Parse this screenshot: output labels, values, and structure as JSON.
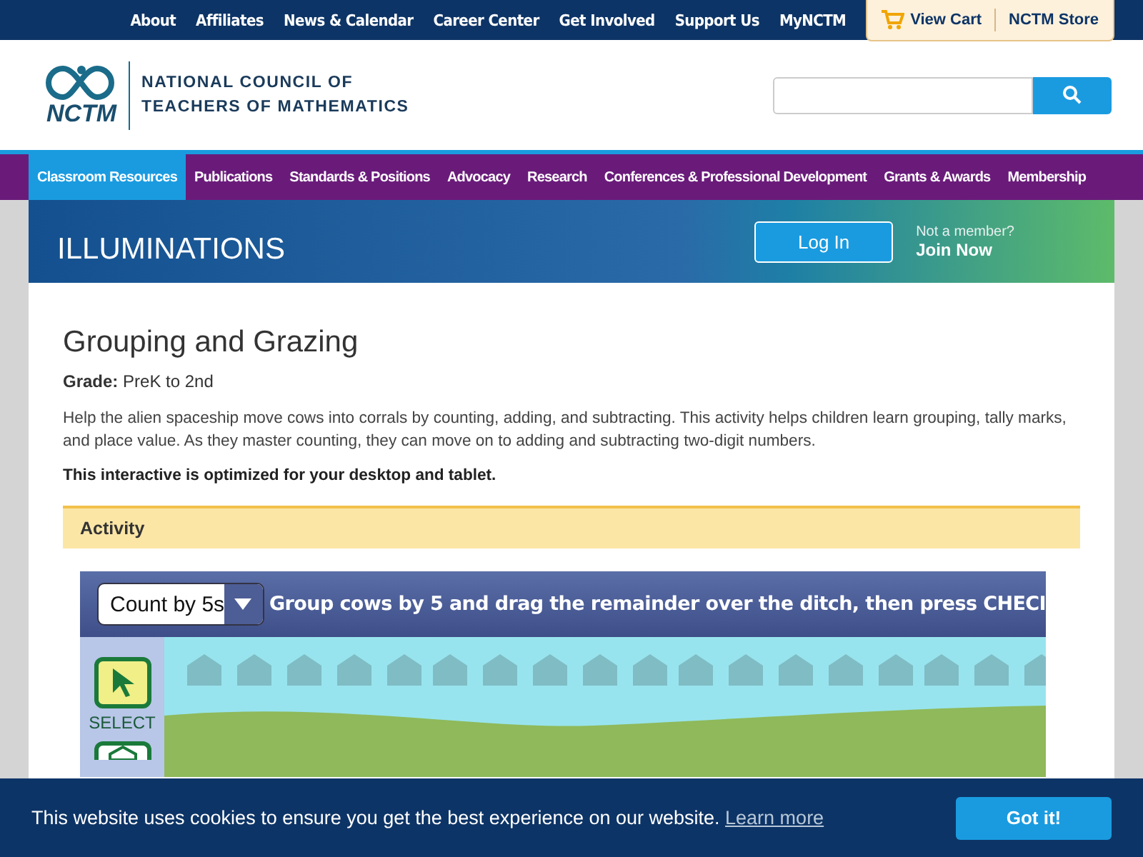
{
  "top_links": [
    "About",
    "Affiliates",
    "News & Calendar",
    "Career Center",
    "Get Involved",
    "Support Us",
    "MyNCTM"
  ],
  "cart": {
    "view_cart": "View Cart",
    "store": "NCTM Store"
  },
  "logo": {
    "mark": "NCTM",
    "name_line_1": "NATIONAL COUNCIL OF",
    "name_line_2": "TEACHERS OF MATHEMATICS"
  },
  "nav": [
    {
      "label": "Classroom Resources",
      "selected": true
    },
    {
      "label": "Publications",
      "selected": false
    },
    {
      "label": "Standards & Positions",
      "selected": false
    },
    {
      "label": "Advocacy",
      "selected": false
    },
    {
      "label": "Research",
      "selected": false
    },
    {
      "label": "Conferences & Professional Development",
      "selected": false
    },
    {
      "label": "Grants & Awards",
      "selected": false
    },
    {
      "label": "Membership",
      "selected": false
    }
  ],
  "banner": {
    "title": "ILLUMINATIONS",
    "login": "Log In",
    "not_member": "Not a member?",
    "join": "Join Now"
  },
  "title": "Grouping and Grazing",
  "grade": "**Grade:** PreK to 2nd",
  "description": "Help the alien spaceship move cows into corrals by counting, adding, and subtracting. This activity helps children learn grouping, tally marks, and place value. As they master counting, they can move on to adding and subtracting two-digit numbers.",
  "note": "This interactive is optimized for your desktop and tablet.",
  "activity": {
    "heading": "Activity",
    "mode": "Count by 5s",
    "instruction": "Group cows by 5 and drag the remainder over the ditch, then press CHECI",
    "tools": [
      {
        "kind": "select",
        "label": "SELECT",
        "selected": true
      },
      {
        "kind": "corral",
        "selected": false
      }
    ]
  },
  "cookie": {
    "text": "This website uses cookies to ensure you get the best experience on our website.",
    "link": "Learn more",
    "button": "Got it!"
  }
}
